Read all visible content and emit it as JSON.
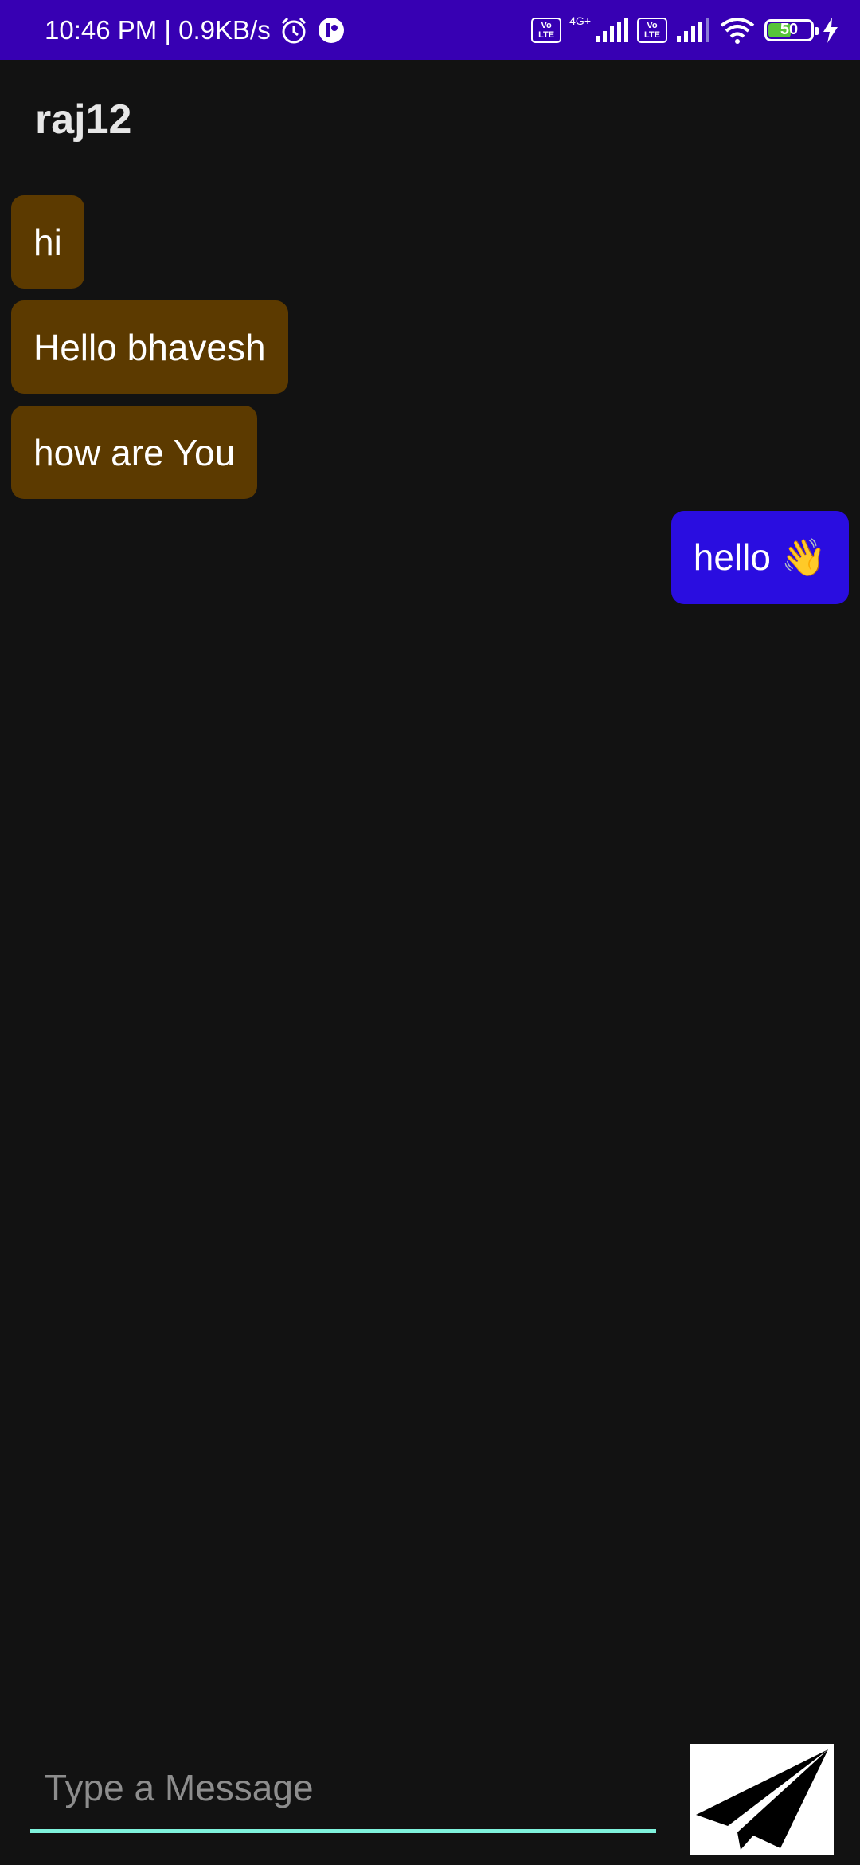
{
  "status_bar": {
    "time": "10:46 PM | 0.9KB/s",
    "volte1": "Vo LTE",
    "network": "4G+",
    "volte2": "Vo LTE",
    "battery": "50",
    "icons": [
      "alarm-icon",
      "app-icon",
      "signal-icon",
      "wifi-icon",
      "battery-icon",
      "charging-icon"
    ]
  },
  "header": {
    "title": "raj12"
  },
  "messages": [
    {
      "direction": "incoming",
      "text": "hi"
    },
    {
      "direction": "incoming",
      "text": "Hello bhavesh"
    },
    {
      "direction": "incoming",
      "text": "how are You"
    },
    {
      "direction": "outgoing",
      "text": "hello 👋"
    }
  ],
  "composer": {
    "placeholder": "Type a Message",
    "value": "",
    "send_icon": "paper-plane-icon"
  },
  "colors": {
    "status_bar": "#3700b3",
    "background": "#121212",
    "incoming_bubble": "#5c3a00",
    "outgoing_bubble": "#2a0de0",
    "input_underline": "#7ff2dc"
  }
}
